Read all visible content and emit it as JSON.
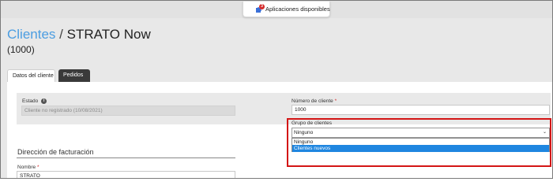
{
  "topbar": {
    "apps_label": "Aplicaciones disponibles",
    "apps_badge": "3",
    "apps_icon": "puzzle-icon"
  },
  "header": {
    "breadcrumb": "Clientes",
    "separator": "/",
    "title": "STRATO Now",
    "subtitle": "(1000)"
  },
  "tabs": [
    {
      "label": "Datos del cliente",
      "active": true
    },
    {
      "label": "Pedidos",
      "active": false
    }
  ],
  "form": {
    "estado_label": "Estado",
    "estado_value": "Cliente no registrado (10/08/2021)",
    "numero_label": "Número de cliente",
    "numero_value": "1000",
    "grupo_label": "Grupo de clientes",
    "grupo_value": "Ninguno",
    "grupo_options": [
      "Ninguno",
      "Clientes nuevos"
    ],
    "grupo_highlighted": "Clientes nuevos",
    "section_title": "Dirección de facturación",
    "nombre_label": "Nombre",
    "nombre_value": "STRATO",
    "required_marker": "*"
  },
  "colors": {
    "accent": "#4b9de1",
    "highlight_border": "#d31515",
    "selected_option": "#1f86e0"
  }
}
